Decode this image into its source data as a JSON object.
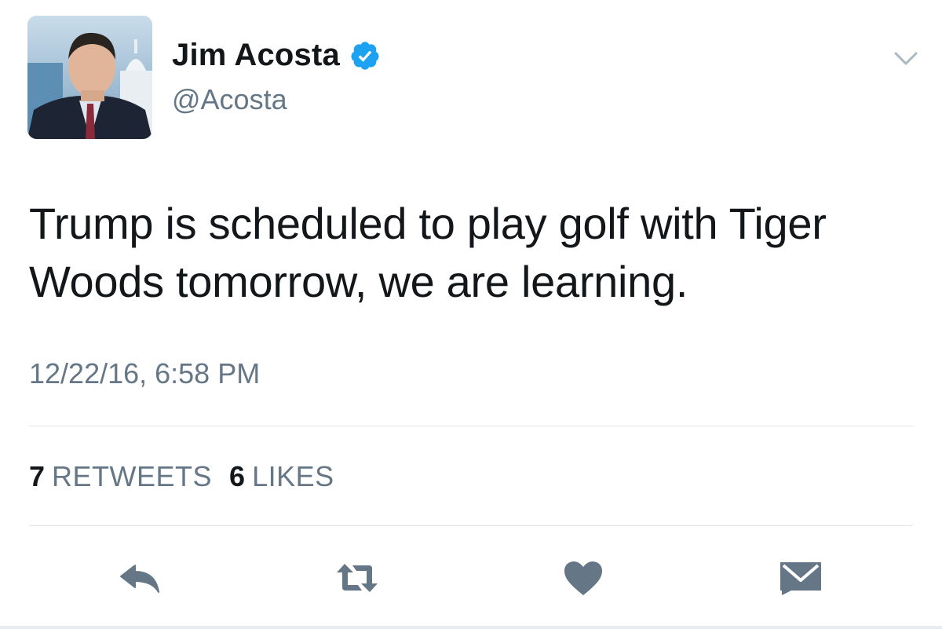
{
  "user": {
    "display_name": "Jim Acosta",
    "handle": "@Acosta",
    "verified": true,
    "avatar_icon": "profile-photo"
  },
  "tweet": {
    "text": "Trump is scheduled to play golf with Tiger Woods tomorrow, we are learning.",
    "timestamp": "12/22/16, 6:58 PM"
  },
  "stats": {
    "retweets_count": "7",
    "retweets_label": "RETWEETS",
    "likes_count": "6",
    "likes_label": "LIKES"
  },
  "actions": {
    "reply_icon": "reply-icon",
    "retweet_icon": "retweet-icon",
    "like_icon": "heart-icon",
    "dm_icon": "envelope-icon"
  },
  "colors": {
    "text_primary": "#14171a",
    "text_secondary": "#657786",
    "verified_blue": "#1da1f2",
    "icon_gray": "#657786",
    "divider": "#dde3e8"
  }
}
